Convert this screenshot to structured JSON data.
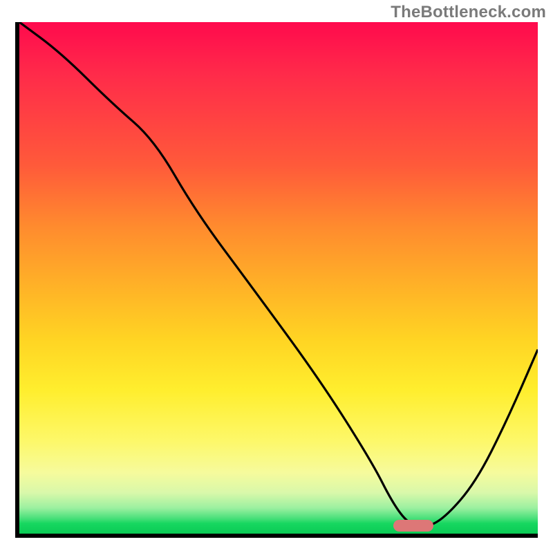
{
  "attribution": "TheBottleneck.com",
  "chart_data": {
    "type": "line",
    "title": "",
    "xlabel": "",
    "ylabel": "",
    "xlim": [
      0,
      100
    ],
    "ylim": [
      0,
      100
    ],
    "grid": false,
    "legend": false,
    "series": [
      {
        "name": "bottleneck-curve",
        "x": [
          0,
          8,
          18,
          26,
          34,
          45,
          58,
          68,
          72,
          75,
          78,
          82,
          88,
          94,
          100
        ],
        "values": [
          100,
          94,
          84,
          77,
          63,
          48,
          30,
          14,
          6,
          2,
          1,
          3,
          10,
          22,
          36
        ]
      }
    ],
    "annotations": [
      {
        "name": "optimal-marker",
        "x": 76,
        "y": 1.5
      }
    ],
    "background_gradient": {
      "orientation": "vertical",
      "stops": [
        {
          "pos": 0.0,
          "color": "#ff0a4d"
        },
        {
          "pos": 0.4,
          "color": "#ff8b2e"
        },
        {
          "pos": 0.72,
          "color": "#ffee2e"
        },
        {
          "pos": 0.95,
          "color": "#9bf0a0"
        },
        {
          "pos": 1.0,
          "color": "#0acb55"
        }
      ]
    }
  }
}
